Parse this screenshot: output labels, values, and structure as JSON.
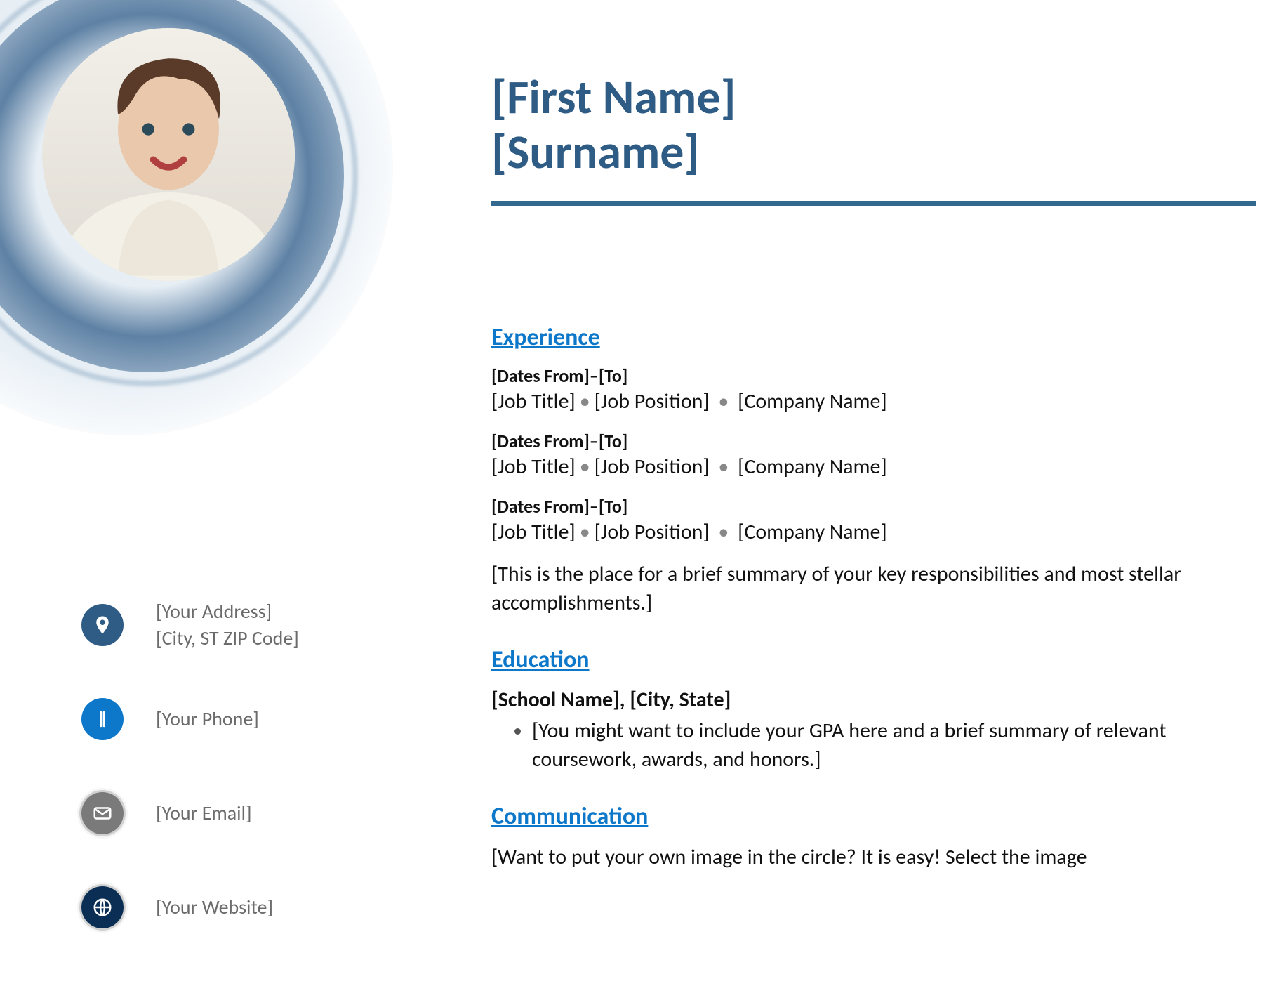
{
  "header": {
    "first_name": "[First Name]",
    "surname": "[Surname]"
  },
  "sidebar": {
    "address_line1": "[Your Address]",
    "address_line2": "[City, ST ZIP Code]",
    "phone": "[Your Phone]",
    "email": "[Your Email]",
    "website": "[Your Website]",
    "icons": {
      "location": "location-pin-icon",
      "phone": "phone-icon",
      "email": "email-icon",
      "website": "globe-icon"
    },
    "icon_colors": {
      "location": "#2e5c85",
      "phone": "#0d78c9",
      "email": "#7a7a7a",
      "website": "#0b2e55"
    }
  },
  "sections": {
    "experience": {
      "heading": "Experience",
      "entries": [
        {
          "dates": "[Dates From]–[To]",
          "title": "[Job Title]",
          "position": "[Job Position]",
          "company": "[Company Name]"
        },
        {
          "dates": "[Dates From]–[To]",
          "title": "[Job Title]",
          "position": "[Job Position]",
          "company": "[Company Name]"
        },
        {
          "dates": "[Dates From]–[To]",
          "title": "[Job Title]",
          "position": "[Job Position]",
          "company": "[Company Name]"
        }
      ],
      "summary": "[This is the place for a brief summary of your key responsibilities and most stellar accomplishments.]"
    },
    "education": {
      "heading": "Education",
      "school": "[School Name], [City, State]",
      "bullet": "[You might want to include your GPA here and a brief summary of relevant coursework, awards, and honors.]"
    },
    "communication": {
      "heading": "Communication",
      "text": "[Want to put your own image in the circle?  It is easy!  Select the image"
    }
  },
  "colors": {
    "accent_dark": "#2e5c85",
    "accent_bright": "#0d78c9"
  }
}
